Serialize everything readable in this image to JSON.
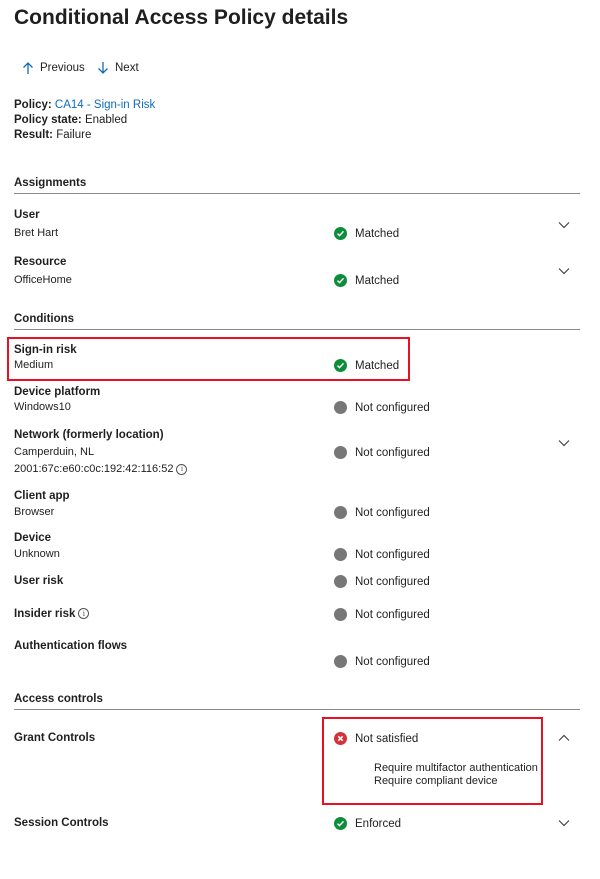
{
  "page": {
    "title": "Conditional Access Policy details"
  },
  "nav": {
    "previous": "Previous",
    "next": "Next"
  },
  "policy": {
    "policy_label": "Policy:",
    "policy_value": "CA14 - Sign-in Risk",
    "state_label": "Policy state:",
    "state_value": "Enabled",
    "result_label": "Result:",
    "result_value": "Failure"
  },
  "sections": {
    "assignments": "Assignments",
    "conditions": "Conditions",
    "access_controls": "Access controls"
  },
  "assignments": {
    "user": {
      "label": "User",
      "value": "Bret Hart",
      "status": "Matched"
    },
    "resource": {
      "label": "Resource",
      "value": "OfficeHome",
      "status": "Matched"
    }
  },
  "conditions": {
    "signin_risk": {
      "label": "Sign-in risk",
      "value": "Medium",
      "status": "Matched"
    },
    "device_platform": {
      "label": "Device platform",
      "value": "Windows10",
      "status": "Not configured"
    },
    "network": {
      "label": "Network (formerly location)",
      "value": "Camperduin, NL",
      "value2": "2001:67c:e60:c0c:192:42:116:52",
      "status": "Not configured"
    },
    "client_app": {
      "label": "Client app",
      "value": "Browser",
      "status": "Not configured"
    },
    "device": {
      "label": "Device",
      "value": "Unknown",
      "status": "Not configured"
    },
    "user_risk": {
      "label": "User risk",
      "status": "Not configured"
    },
    "insider_risk": {
      "label": "Insider risk",
      "status": "Not configured"
    },
    "auth_flows": {
      "label": "Authentication flows",
      "status": "Not configured"
    }
  },
  "access_controls": {
    "grant": {
      "label": "Grant Controls",
      "status": "Not satisfied",
      "requirements": [
        "Require multifactor authentication",
        "Require compliant device"
      ]
    },
    "session": {
      "label": "Session Controls",
      "status": "Enforced"
    }
  },
  "colors": {
    "matched": "#0c8d3a",
    "not_configured": "#777777",
    "error": "#d13438",
    "highlight": "#e81123",
    "link": "#0f6cbd"
  },
  "icons": [
    "arrow-up-icon",
    "arrow-down-icon",
    "check-circle-icon",
    "gray-circle-icon",
    "error-circle-icon",
    "chevron-down-icon",
    "chevron-up-icon",
    "info-icon"
  ]
}
